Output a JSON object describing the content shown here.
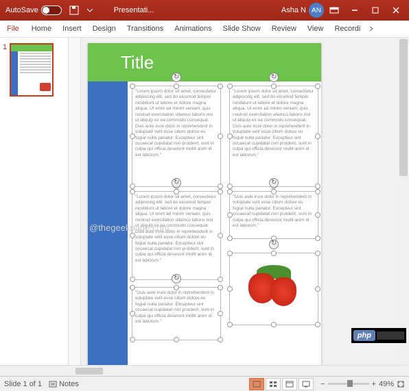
{
  "titlebar": {
    "autosave_label": "AutoSave",
    "autosave_state": "Off",
    "doc_title": "Presentati...",
    "username": "Asha N",
    "user_initials": "AN"
  },
  "ribbon": {
    "file": "File",
    "tabs": [
      "Home",
      "Insert",
      "Design",
      "Transitions",
      "Animations",
      "Slide Show",
      "Review",
      "View",
      "Recordi"
    ]
  },
  "thumbnails": {
    "items": [
      {
        "num": "1"
      }
    ]
  },
  "slide": {
    "title": "Title",
    "lorem1": "\"Lorem ipsum dolor sit amet, consectetur adipiscing elit, sed do eiusmod tempor incididunt ut labore et dolore magna aliqua. Ut enim ad minim veniam, quis nostrud exercitation ullamco laboris nisi ut aliquip ex ea commodo consequat. Duis aute irure dolor in reprehenderit in voluptate velit esse cillum dolore eu fugiat nulla pariatur. Excepteur sint occaecat cupidatat non proident, sunt in culpa qui officia deserunt mollit anim id est laborum.\"",
    "lorem2": "\"Lorem ipsum dolor sit amet, consectetur adipiscing elit, sed do eiusmod tempor incididunt ut labore et dolore magna aliqua. Ut enim ad minim veniam, quis nostrud exercitation ullamco laboris nisi ut aliquip ex ea commodo consequat. Duis aute irure dolor in reprehenderit in voluptate velit esse cillum dolore eu fugiat nulla pariatur. Excepteur sint occaecat cupidatat non proident, sunt in culpa qui officia deserunt mollit anim id est laborum.\"",
    "lorem3": "\"Lorem ipsum dolor sit amet, consectetur adipiscing elit, sed do eiusmod tempor incididunt ut labore et dolore magna aliqua. Ut enim ad minim veniam, quis nostrud exercitation ullamco laboris nisi ut aliquip ex ea commodo consequat. Duis aute irure dolor in reprehenderit in voluptate velit esse cillum dolore eu fugiat nulla pariatur. Excepteur sint occaecat cupidatat non proident, sunt in culpa qui officia deserunt mollit anim id est laborum.\"",
    "lorem4": "\"Duis aute irure dolor in reprehenderit in voluptate velit esse cillum dolore eu fugiat nulla pariatur. Excepteur sint occaecat cupidatat non proident, sunt in culpa qui officia deserunt mollit anim id est laborum.\"",
    "lorem5": "\"Duis aute irure dolor in reprehenderit in voluptate velit esse cillum dolore eu fugiat nulla pariatur. Excepteur sint occaecat cupidatat non proident, sunt in culpa qui officia deserunt mollit anim id est laborum.\""
  },
  "watermark": "@thegeekpage.com",
  "statusbar": {
    "slide_info": "Slide 1 of 1",
    "notes_label": "Notes",
    "zoom_minus": "−",
    "zoom_plus": "+",
    "zoom_value": "49%"
  },
  "php_badge": "php"
}
